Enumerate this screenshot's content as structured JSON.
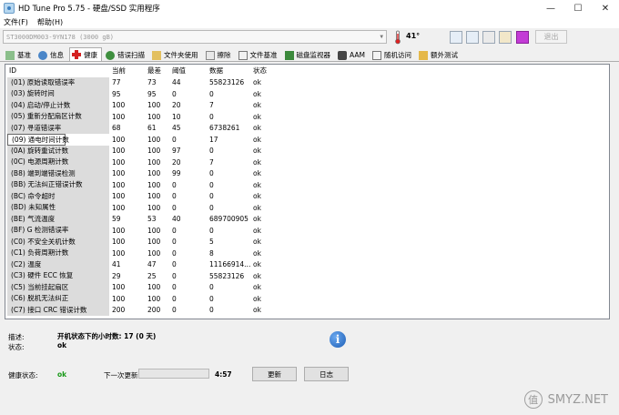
{
  "window": {
    "title": "HD Tune Pro 5.75 - 硬盘/SSD 实用程序",
    "minimize": "—",
    "maximize": "☐",
    "close": "✕"
  },
  "menu": {
    "items": [
      "文件(F)",
      "帮助(H)"
    ]
  },
  "toolbar": {
    "drive": "ST3000DM003-9YN178 (3000 gB)",
    "temperature": "41°",
    "exit_label": "退出",
    "icons": [
      "copy-icon",
      "copy-all-icon",
      "camera-icon",
      "options-icon",
      "download-icon"
    ]
  },
  "tabs": [
    {
      "label": "基准",
      "icon": "benchmark-icon"
    },
    {
      "label": "信息",
      "icon": "info-icon"
    },
    {
      "label": "健康",
      "icon": "health-icon"
    },
    {
      "label": "错误扫描",
      "icon": "error-scan-icon"
    },
    {
      "label": "文件夹使用",
      "icon": "folder-icon"
    },
    {
      "label": "擦除",
      "icon": "erase-icon"
    },
    {
      "label": "文件基准",
      "icon": "file-benchmark-icon"
    },
    {
      "label": "磁盘监视器",
      "icon": "monitor-icon"
    },
    {
      "label": "AAM",
      "icon": "speaker-icon"
    },
    {
      "label": "随机访问",
      "icon": "random-access-icon"
    },
    {
      "label": "额外测试",
      "icon": "extra-tests-icon"
    }
  ],
  "table": {
    "headers": {
      "id": "ID",
      "current": "当前",
      "worst": "最差",
      "threshold": "阈值",
      "data": "数据",
      "status": "状态"
    },
    "rows": [
      {
        "id": "(01) 原始读取错误率",
        "current": "77",
        "worst": "73",
        "threshold": "44",
        "data": "55823126",
        "status": "ok"
      },
      {
        "id": "(03) 旋转时间",
        "current": "95",
        "worst": "95",
        "threshold": "0",
        "data": "0",
        "status": "ok"
      },
      {
        "id": "(04) 启动/停止计数",
        "current": "100",
        "worst": "100",
        "threshold": "20",
        "data": "7",
        "status": "ok"
      },
      {
        "id": "(05) 重新分配扇区计数",
        "current": "100",
        "worst": "100",
        "threshold": "10",
        "data": "0",
        "status": "ok"
      },
      {
        "id": "(07) 寻道错误率",
        "current": "68",
        "worst": "61",
        "threshold": "45",
        "data": "6738261",
        "status": "ok"
      },
      {
        "id": "(09) 通电时间计数",
        "current": "100",
        "worst": "100",
        "threshold": "0",
        "data": "17",
        "status": "ok"
      },
      {
        "id": "(0A) 旋转重试计数",
        "current": "100",
        "worst": "100",
        "threshold": "97",
        "data": "0",
        "status": "ok"
      },
      {
        "id": "(0C) 电源周期计数",
        "current": "100",
        "worst": "100",
        "threshold": "20",
        "data": "7",
        "status": "ok"
      },
      {
        "id": "(B8) 端到端错误检测",
        "current": "100",
        "worst": "100",
        "threshold": "99",
        "data": "0",
        "status": "ok"
      },
      {
        "id": "(BB) 无法纠正错误计数",
        "current": "100",
        "worst": "100",
        "threshold": "0",
        "data": "0",
        "status": "ok"
      },
      {
        "id": "(BC) 命令超时",
        "current": "100",
        "worst": "100",
        "threshold": "0",
        "data": "0",
        "status": "ok"
      },
      {
        "id": "(BD) 未知属性",
        "current": "100",
        "worst": "100",
        "threshold": "0",
        "data": "0",
        "status": "ok"
      },
      {
        "id": "(BE) 气流温度",
        "current": "59",
        "worst": "53",
        "threshold": "40",
        "data": "689700905",
        "status": "ok"
      },
      {
        "id": "(BF) G 检测错误率",
        "current": "100",
        "worst": "100",
        "threshold": "0",
        "data": "0",
        "status": "ok"
      },
      {
        "id": "(C0) 不安全关机计数",
        "current": "100",
        "worst": "100",
        "threshold": "0",
        "data": "5",
        "status": "ok"
      },
      {
        "id": "(C1) 负荷周期计数",
        "current": "100",
        "worst": "100",
        "threshold": "0",
        "data": "8",
        "status": "ok"
      },
      {
        "id": "(C2) 温度",
        "current": "41",
        "worst": "47",
        "threshold": "0",
        "data": "11166914...",
        "status": "ok"
      },
      {
        "id": "(C3) 硬件 ECC 恢复",
        "current": "29",
        "worst": "25",
        "threshold": "0",
        "data": "55823126",
        "status": "ok"
      },
      {
        "id": "(C5) 当前挂起扇区",
        "current": "100",
        "worst": "100",
        "threshold": "0",
        "data": "0",
        "status": "ok"
      },
      {
        "id": "(C6) 脱机无法纠正",
        "current": "100",
        "worst": "100",
        "threshold": "0",
        "data": "0",
        "status": "ok"
      },
      {
        "id": "(C7) 接口 CRC 错误计数",
        "current": "200",
        "worst": "200",
        "threshold": "0",
        "data": "0",
        "status": "ok"
      }
    ]
  },
  "details": {
    "description_label": "描述:",
    "description_value": "开机状态下的小时数: 17 (0 天)",
    "status_label": "状态:",
    "status_value": "ok"
  },
  "footer": {
    "health_label": "健康状态:",
    "health_value": "ok",
    "next_update_label": "下一次更新:",
    "timer": "4:57",
    "refresh_label": "更新",
    "log_label": "日志"
  },
  "watermark": {
    "logo_char": "值",
    "text": "SMYZ.NET"
  },
  "colors": {
    "health_ok": "#1a9a1a",
    "selection_bg": "#dcdcdc"
  }
}
